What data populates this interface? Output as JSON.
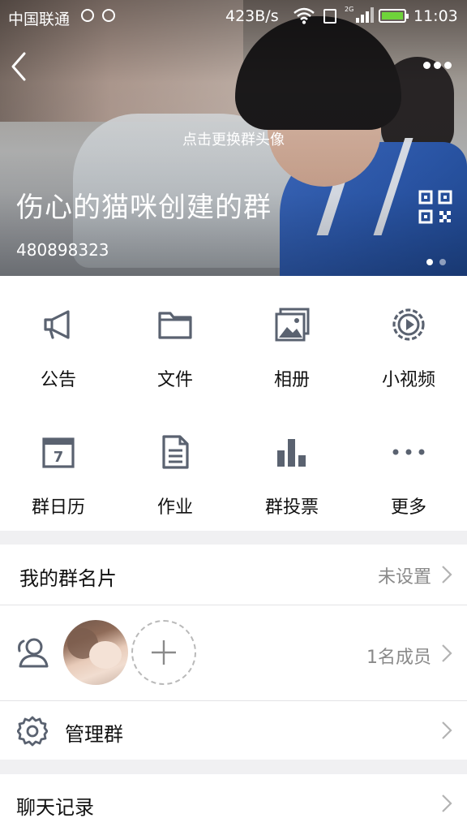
{
  "status_bar": {
    "carrier": "中国联通",
    "net_speed": "423B/s",
    "network_type": "2G",
    "time": "11:03"
  },
  "header": {
    "avatar_hint": "点击更换群头像",
    "group_name": "伤心的猫咪创建的群",
    "group_id": "480898323",
    "page_indicator": {
      "count": 2,
      "active": 1
    }
  },
  "functions": [
    {
      "label": "公告",
      "icon": "megaphone-icon"
    },
    {
      "label": "文件",
      "icon": "folder-icon"
    },
    {
      "label": "相册",
      "icon": "album-icon"
    },
    {
      "label": "小视频",
      "icon": "video-icon"
    },
    {
      "label": "群日历",
      "icon": "calendar-icon",
      "calendar_day": "7"
    },
    {
      "label": "作业",
      "icon": "document-icon"
    },
    {
      "label": "群投票",
      "icon": "bar-chart-icon"
    },
    {
      "label": "更多",
      "icon": "more-dots-icon"
    }
  ],
  "my_card": {
    "label": "我的群名片",
    "value": "未设置"
  },
  "members": {
    "count_text": "1名成员"
  },
  "manage": {
    "label": "管理群"
  },
  "chat_history": {
    "label": "聊天记录"
  },
  "colors": {
    "icon": "#5a6270",
    "text": "#111111",
    "muted": "#8a8a8a",
    "background": "#f0f0f2",
    "accent_battery": "#6fd33a"
  }
}
